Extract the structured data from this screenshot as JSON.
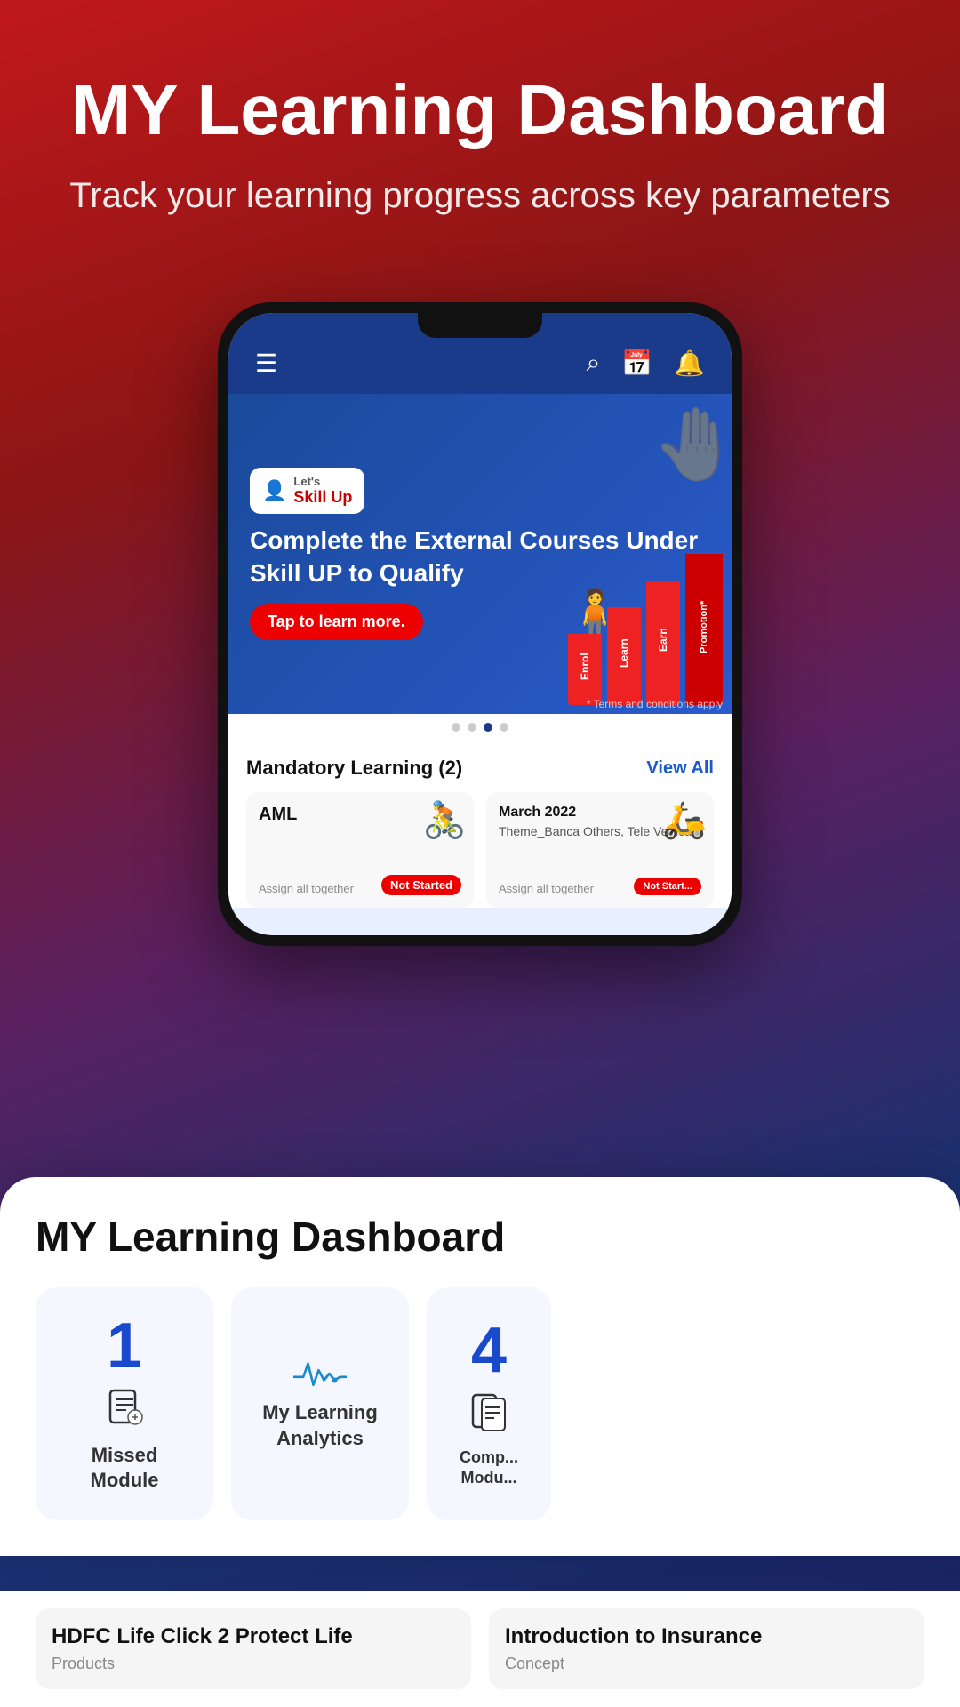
{
  "hero": {
    "title": "MY Learning Dashboard",
    "subtitle": "Track your learning progress across key parameters"
  },
  "app": {
    "navbar": {
      "hamburger": "☰",
      "search_icon": "🔍",
      "calendar_icon": "📅",
      "bell_icon": "🔔"
    },
    "banner": {
      "badge_lets": "Let's",
      "badge_skillup": "Skill Up",
      "heading": "Complete the External Courses Under Skill UP to Qualify",
      "cta": "Tap to learn more.",
      "terms": "* Terms and conditions apply",
      "stairs": [
        "Enrol",
        "Learn",
        "Earn"
      ],
      "stair_top": "Promotion*"
    },
    "dots": [
      "",
      "",
      "",
      ""
    ],
    "mandatory": {
      "section_title": "Mandatory Learning (2)",
      "view_all": "View All",
      "courses": [
        {
          "name": "AML",
          "assign": "Assign all together",
          "status": "Not Started",
          "figure": "🚴"
        },
        {
          "name": "March 2022",
          "info": "Theme_Banca Others, Tele Verticals",
          "assign": "Assign all together",
          "status": "Not Start...",
          "figure": "🛵"
        }
      ]
    }
  },
  "dashboard": {
    "title": "MY Learning Dashboard",
    "stats": [
      {
        "id": "missed",
        "number": "1",
        "icon": "📋",
        "label": "Missed Module"
      },
      {
        "id": "analytics",
        "number": "",
        "icon": "pulse",
        "label": "My Learning Analytics"
      },
      {
        "id": "completed",
        "number": "4",
        "icon": "📋",
        "label": "Comp... Modu..."
      }
    ]
  },
  "bottom_courses": [
    {
      "name": "HDFC Life Click 2 Protect Life",
      "tag": "Products"
    },
    {
      "name": "Introduction to Insurance",
      "tag": "Concept"
    }
  ]
}
